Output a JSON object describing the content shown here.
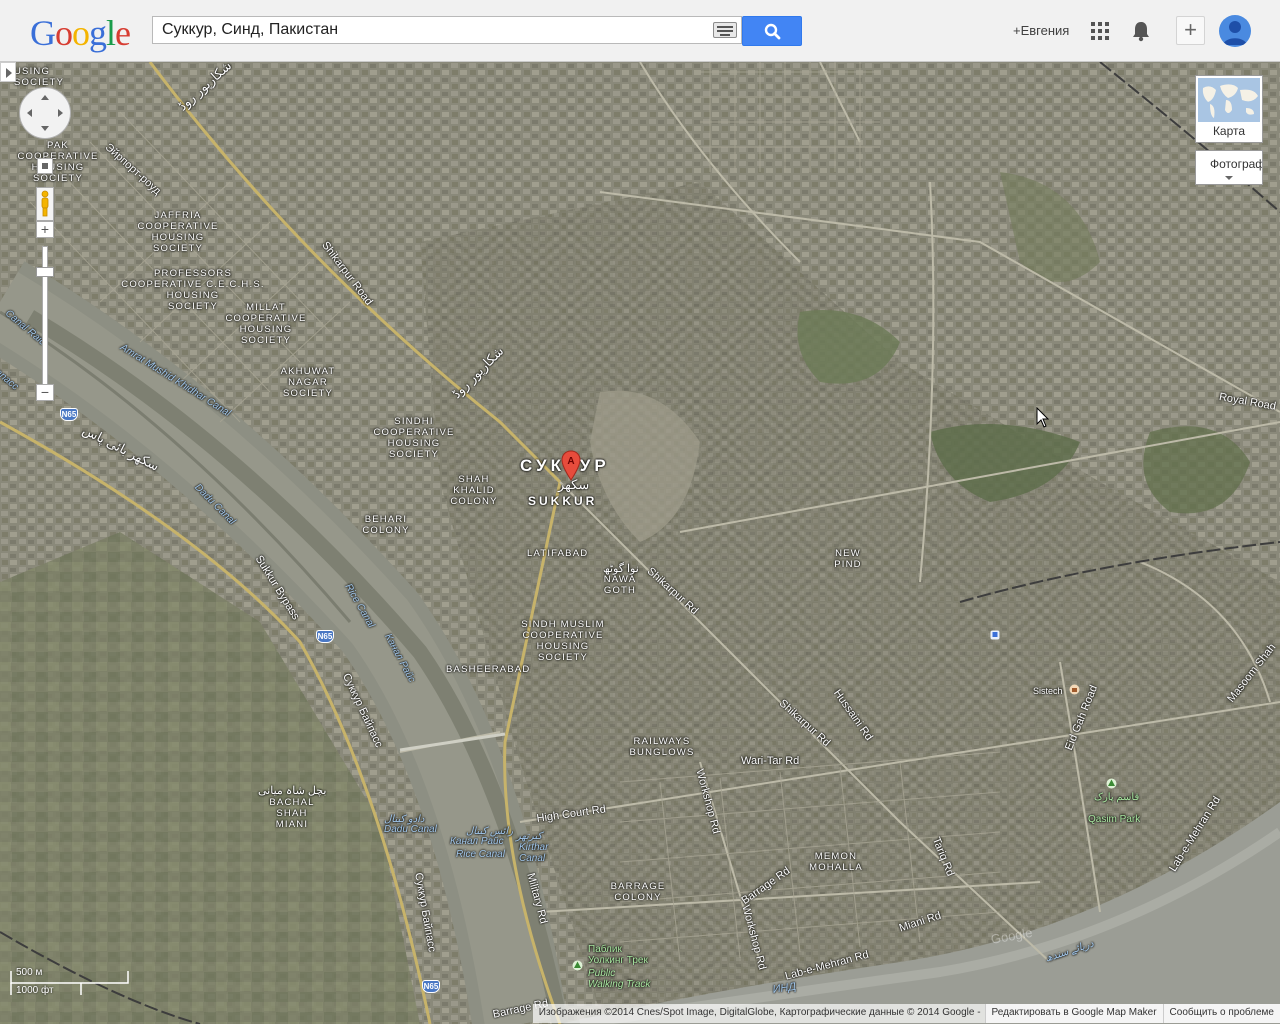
{
  "header": {
    "logo": [
      "G",
      "o",
      "o",
      "g",
      "l",
      "e"
    ],
    "logo_colors": [
      "#3a6fd8",
      "#d73d32",
      "#f4b400",
      "#3a6fd8",
      "#1a9c4b",
      "#d73d32"
    ],
    "search": {
      "value": "Суккур, Синд, Пакистан"
    },
    "user_label": "+Евгения"
  },
  "map_type": {
    "map_label": "Карта",
    "satellite_label": "Фотограф"
  },
  "labels": {
    "city_ru": "СУККУР",
    "city_en": "SUKKUR",
    "city_urdu": "سکھر",
    "pak_housing": "PAK\nCOOPERATIVE\nHOUSING\nSOCIETY",
    "housing_top": "USING\nSOCIETY",
    "jafferia": "JAFFRIA\nCOOPERATIVE\nHOUSING\nSOCIETY",
    "professors": "PROFESSORS\nCOOPERATIVE C.E.C.H.S.\nHOUSING\nSOCIETY",
    "millat": "MILLAT\nCOOPERATIVE\nHOUSING\nSOCIETY",
    "akhuwat": "AKHUWAT\nNAGAR\nSOCIETY",
    "sindhi": "SINDHI\nCOOPERATIVE\nHOUSING\nSOCIETY",
    "shah_khalid": "SHAH\nKHALID\nCOLONY",
    "behari": "BEHARI\nCOLONY",
    "latifabad": "LATIFABAD",
    "nawa_goth": "NAWA\nGOTH",
    "nawa_urdu": "نوا گوٹھ",
    "sindh_muslim": "SINDH MUSLIM\nCOOPERATIVE\nHOUSING\nSOCIETY",
    "basheerabad": "BASHEERABAD",
    "railways": "RAILWAYS\nBUNGLOWS",
    "new_pind": "NEW\nPIND",
    "memon": "MEMON\nMOHALLA",
    "barrage_colony": "BARRAGE\nCOLONY",
    "bachal_urdu": "بچل شاہ میانی",
    "bachal": "BACHAL\nSHAH\nMIANI",
    "airport_road": "Эйрпорт-роуд",
    "shikarpur_road": "Shikarpur Road",
    "shikarpur_rd1": "Shikarpur Rd",
    "shikarpur_rd2": "Shikarpur Rd",
    "shikarpur_urdu1": "شکارپور روڈ",
    "shikarpur_urdu2": "شکارپور روڈ",
    "sukkur_bypass": "Sukkur Bypass",
    "sukkur_bypass_ru1": "Суккур Байпасс",
    "sukkur_bypass_ru2": "Суккур Байпасс",
    "bypass_urdu": "سکھر بائی پاس",
    "amrat": "Amrat Mushid Khidhar Canal",
    "dadu_canal": "Dadu Canal",
    "rice_canal": "Rice Canal",
    "kanal_rais": "Канал Райс",
    "kanal_rais2": "Канал Райс",
    "rice_canal2": "Rice Canal",
    "dadu_canal2": "Dadu Canal",
    "kirthar": "Kirthar\nCanal",
    "kirthar_urdu": "کیرتھر",
    "dadu_urdu": "دادو کینال",
    "rais_urdu": "رائس کینال",
    "military": "Military Rd",
    "high_court": "High Court Rd",
    "workshop1": "Workshop Rd",
    "workshop2": "Workshop Rd",
    "wari_tar": "Wari-Tar Rd",
    "hussaini": "Hussaini Rd",
    "eid_gah": "Eid Gah Road",
    "royal": "Royal Road",
    "masoom": "Masoom Shah",
    "tariq": "Tariq Rd",
    "miani": "Miani Rd",
    "barrage_rd": "Barrage Rd",
    "barrage_rd2": "Barrage Rd",
    "lab_mehran": "Lab-e-Mehran Rd",
    "lab_mehran2": "Lab-e-Mehran Rd",
    "sistech": "Sistech",
    "qasim_park": "Qasim Park",
    "qasim_urdu": "قاسم پارک",
    "public_walk": "Паблик\nУолкинг Трек",
    "public_walk_en": "Public\nWalking Track",
    "indus": "ИНД",
    "indus_urdu": "دریائے سندھ",
    "eanalp": "Canal Raic",
    "canal_left": "Canal Raic",
    "anacc": "anacc",
    "google_wm": "Google",
    "n65a": "N65",
    "n65b": "N65",
    "n65c": "N65",
    "marker": "A"
  },
  "scale": {
    "metric": "500 м",
    "imperial": "1000 фт"
  },
  "footer": {
    "attribution": "Изображения ©2014 Cnes/Spot Image, DigitalGlobe, Картографические данные © 2014 Google -",
    "edit": "Редактировать в Google Map Maker",
    "report": "Сообщить о проблеме"
  }
}
